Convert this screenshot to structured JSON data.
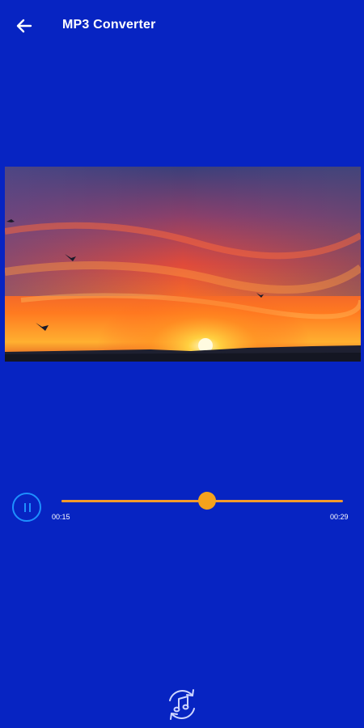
{
  "appbar": {
    "title": "MP3 Converter",
    "back_icon": "arrow-left-icon"
  },
  "video": {
    "description_icon": "sunset-video-frame"
  },
  "player": {
    "state": "playing",
    "control_icon": "pause-icon",
    "current_time": "00:15",
    "duration": "00:29",
    "progress": 0.517,
    "accent_color": "#F5A21C",
    "control_color": "#1E90FF"
  },
  "bottom": {
    "convert_icon": "music-convert-icon"
  },
  "colors": {
    "background": "#0724C2",
    "text": "#FFFFFF"
  }
}
